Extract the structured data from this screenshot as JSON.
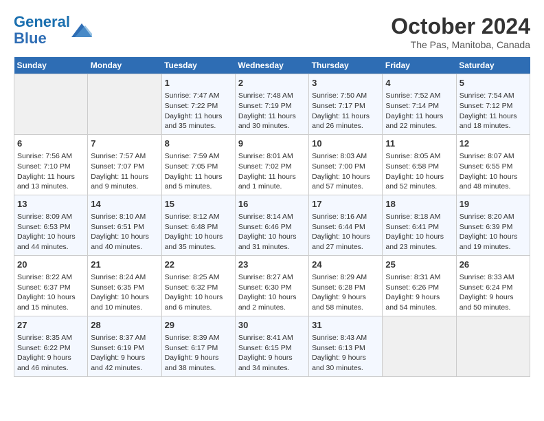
{
  "header": {
    "logo_line1": "General",
    "logo_line2": "Blue",
    "month": "October 2024",
    "location": "The Pas, Manitoba, Canada"
  },
  "weekdays": [
    "Sunday",
    "Monday",
    "Tuesday",
    "Wednesday",
    "Thursday",
    "Friday",
    "Saturday"
  ],
  "weeks": [
    [
      {
        "day": "",
        "info": ""
      },
      {
        "day": "",
        "info": ""
      },
      {
        "day": "1",
        "info": "Sunrise: 7:47 AM\nSunset: 7:22 PM\nDaylight: 11 hours and 35 minutes."
      },
      {
        "day": "2",
        "info": "Sunrise: 7:48 AM\nSunset: 7:19 PM\nDaylight: 11 hours and 30 minutes."
      },
      {
        "day": "3",
        "info": "Sunrise: 7:50 AM\nSunset: 7:17 PM\nDaylight: 11 hours and 26 minutes."
      },
      {
        "day": "4",
        "info": "Sunrise: 7:52 AM\nSunset: 7:14 PM\nDaylight: 11 hours and 22 minutes."
      },
      {
        "day": "5",
        "info": "Sunrise: 7:54 AM\nSunset: 7:12 PM\nDaylight: 11 hours and 18 minutes."
      }
    ],
    [
      {
        "day": "6",
        "info": "Sunrise: 7:56 AM\nSunset: 7:10 PM\nDaylight: 11 hours and 13 minutes."
      },
      {
        "day": "7",
        "info": "Sunrise: 7:57 AM\nSunset: 7:07 PM\nDaylight: 11 hours and 9 minutes."
      },
      {
        "day": "8",
        "info": "Sunrise: 7:59 AM\nSunset: 7:05 PM\nDaylight: 11 hours and 5 minutes."
      },
      {
        "day": "9",
        "info": "Sunrise: 8:01 AM\nSunset: 7:02 PM\nDaylight: 11 hours and 1 minute."
      },
      {
        "day": "10",
        "info": "Sunrise: 8:03 AM\nSunset: 7:00 PM\nDaylight: 10 hours and 57 minutes."
      },
      {
        "day": "11",
        "info": "Sunrise: 8:05 AM\nSunset: 6:58 PM\nDaylight: 10 hours and 52 minutes."
      },
      {
        "day": "12",
        "info": "Sunrise: 8:07 AM\nSunset: 6:55 PM\nDaylight: 10 hours and 48 minutes."
      }
    ],
    [
      {
        "day": "13",
        "info": "Sunrise: 8:09 AM\nSunset: 6:53 PM\nDaylight: 10 hours and 44 minutes."
      },
      {
        "day": "14",
        "info": "Sunrise: 8:10 AM\nSunset: 6:51 PM\nDaylight: 10 hours and 40 minutes."
      },
      {
        "day": "15",
        "info": "Sunrise: 8:12 AM\nSunset: 6:48 PM\nDaylight: 10 hours and 35 minutes."
      },
      {
        "day": "16",
        "info": "Sunrise: 8:14 AM\nSunset: 6:46 PM\nDaylight: 10 hours and 31 minutes."
      },
      {
        "day": "17",
        "info": "Sunrise: 8:16 AM\nSunset: 6:44 PM\nDaylight: 10 hours and 27 minutes."
      },
      {
        "day": "18",
        "info": "Sunrise: 8:18 AM\nSunset: 6:41 PM\nDaylight: 10 hours and 23 minutes."
      },
      {
        "day": "19",
        "info": "Sunrise: 8:20 AM\nSunset: 6:39 PM\nDaylight: 10 hours and 19 minutes."
      }
    ],
    [
      {
        "day": "20",
        "info": "Sunrise: 8:22 AM\nSunset: 6:37 PM\nDaylight: 10 hours and 15 minutes."
      },
      {
        "day": "21",
        "info": "Sunrise: 8:24 AM\nSunset: 6:35 PM\nDaylight: 10 hours and 10 minutes."
      },
      {
        "day": "22",
        "info": "Sunrise: 8:25 AM\nSunset: 6:32 PM\nDaylight: 10 hours and 6 minutes."
      },
      {
        "day": "23",
        "info": "Sunrise: 8:27 AM\nSunset: 6:30 PM\nDaylight: 10 hours and 2 minutes."
      },
      {
        "day": "24",
        "info": "Sunrise: 8:29 AM\nSunset: 6:28 PM\nDaylight: 9 hours and 58 minutes."
      },
      {
        "day": "25",
        "info": "Sunrise: 8:31 AM\nSunset: 6:26 PM\nDaylight: 9 hours and 54 minutes."
      },
      {
        "day": "26",
        "info": "Sunrise: 8:33 AM\nSunset: 6:24 PM\nDaylight: 9 hours and 50 minutes."
      }
    ],
    [
      {
        "day": "27",
        "info": "Sunrise: 8:35 AM\nSunset: 6:22 PM\nDaylight: 9 hours and 46 minutes."
      },
      {
        "day": "28",
        "info": "Sunrise: 8:37 AM\nSunset: 6:19 PM\nDaylight: 9 hours and 42 minutes."
      },
      {
        "day": "29",
        "info": "Sunrise: 8:39 AM\nSunset: 6:17 PM\nDaylight: 9 hours and 38 minutes."
      },
      {
        "day": "30",
        "info": "Sunrise: 8:41 AM\nSunset: 6:15 PM\nDaylight: 9 hours and 34 minutes."
      },
      {
        "day": "31",
        "info": "Sunrise: 8:43 AM\nSunset: 6:13 PM\nDaylight: 9 hours and 30 minutes."
      },
      {
        "day": "",
        "info": ""
      },
      {
        "day": "",
        "info": ""
      }
    ]
  ]
}
